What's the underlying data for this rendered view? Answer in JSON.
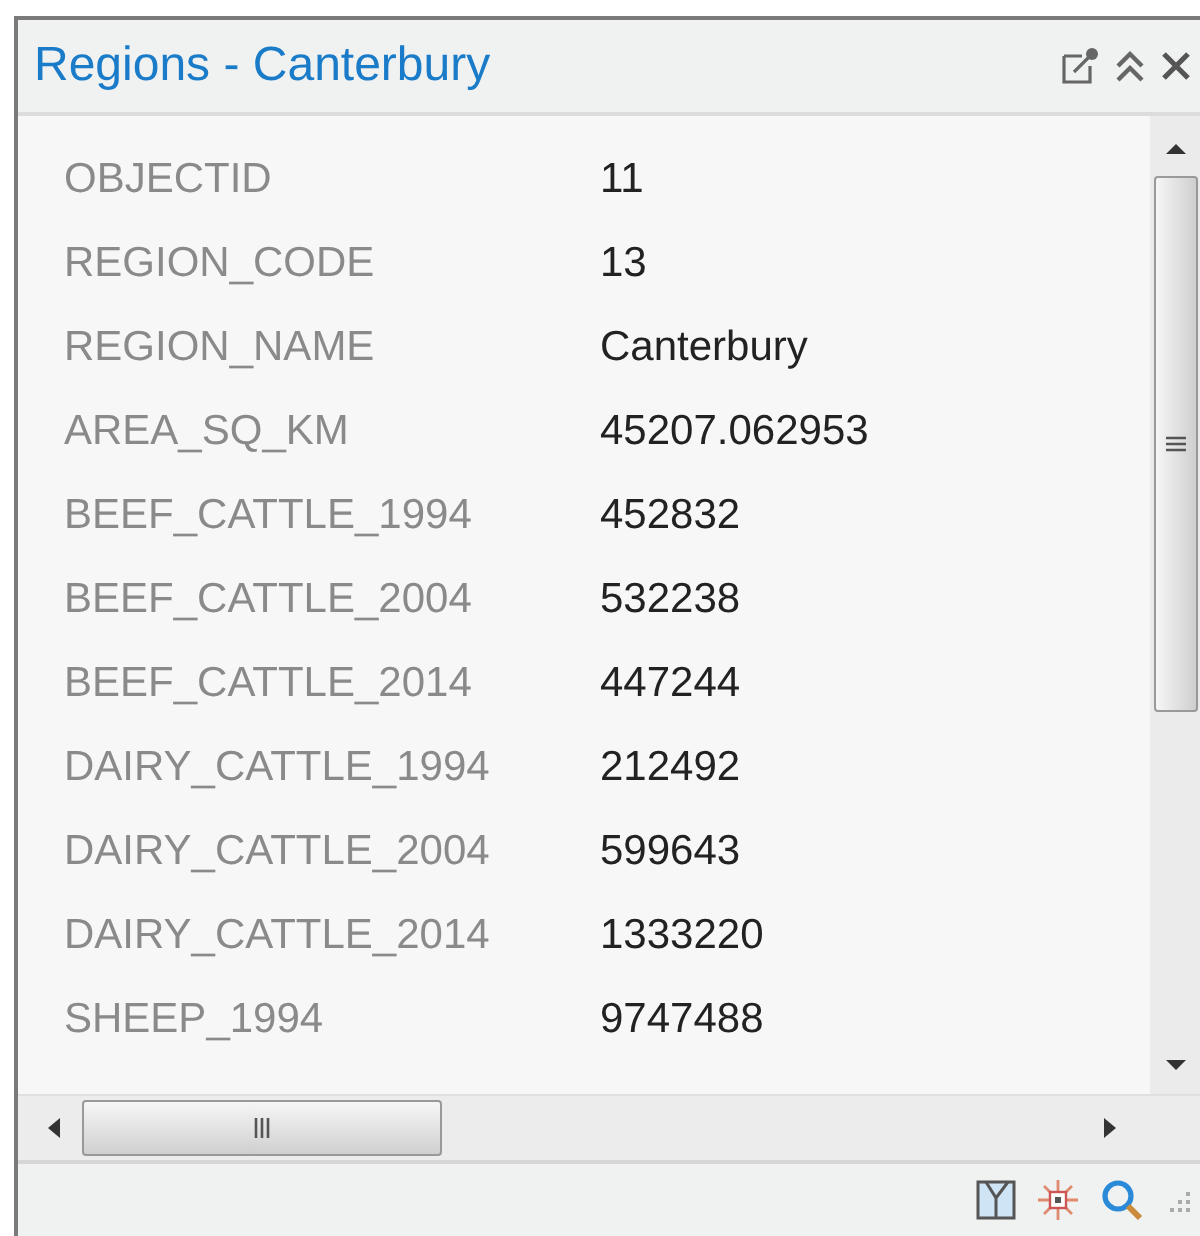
{
  "window": {
    "title": "Regions - Canterbury"
  },
  "attributes": [
    {
      "field": "OBJECTID",
      "value": "11"
    },
    {
      "field": "REGION_CODE",
      "value": "13"
    },
    {
      "field": "REGION_NAME",
      "value": "Canterbury"
    },
    {
      "field": "AREA_SQ_KM",
      "value": "45207.062953"
    },
    {
      "field": "BEEF_CATTLE_1994",
      "value": "452832"
    },
    {
      "field": "BEEF_CATTLE_2004",
      "value": "532238"
    },
    {
      "field": "BEEF_CATTLE_2014",
      "value": "447244"
    },
    {
      "field": "DAIRY_CATTLE_1994",
      "value": "212492"
    },
    {
      "field": "DAIRY_CATTLE_2004",
      "value": "599643"
    },
    {
      "field": "DAIRY_CATTLE_2014",
      "value": "1333220"
    },
    {
      "field": "SHEEP_1994",
      "value": "9747488"
    }
  ]
}
